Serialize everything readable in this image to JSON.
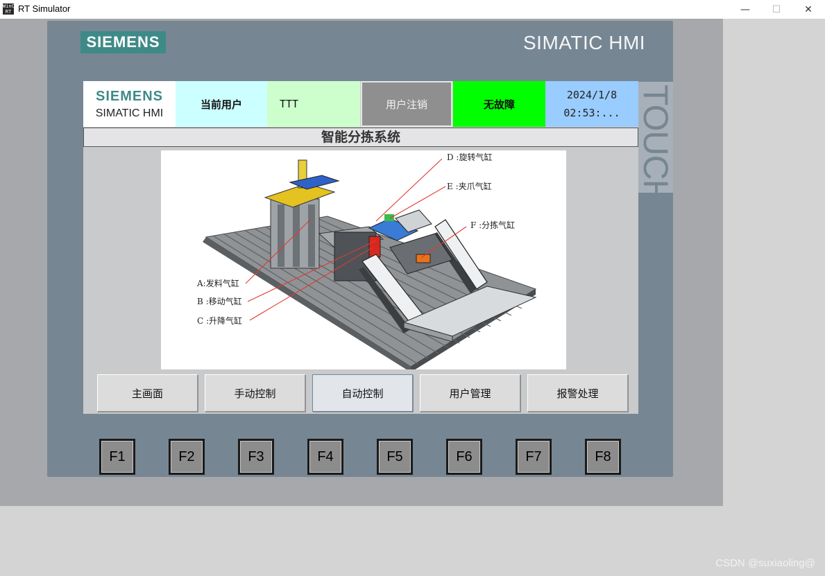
{
  "window": {
    "title": "RT Simulator",
    "icon_text": "WinCC RT",
    "minimize": "—",
    "maximize": "☐",
    "close": "✕"
  },
  "panel": {
    "logo": "SIEMENS",
    "brand": "SIMATIC HMI",
    "touch_label": "TOUCH"
  },
  "header": {
    "logo_line1": "SIEMENS",
    "logo_line2": "SIMATIC HMI",
    "user_label": "当前用户",
    "user_value": "TTT",
    "logout_label": "用户注销",
    "status": "无故障",
    "date": "2024/1/8",
    "time": "02:53:..."
  },
  "screen_title": "智能分拣系统",
  "figure": {
    "labels": {
      "a": "A:发料气缸",
      "b": "B :移动气缸",
      "c": "C :升降气缸",
      "d": "D :旋转气缸",
      "e": "E :夹爪气缸",
      "f": "F :分拣气缸"
    }
  },
  "nav": [
    "主画面",
    "手动控制",
    "自动控制",
    "用户管理",
    "报警处理"
  ],
  "fkeys": [
    "F1",
    "F2",
    "F3",
    "F4",
    "F5",
    "F6",
    "F7",
    "F8"
  ],
  "watermark": "CSDN @suxiaoling@",
  "colors": {
    "siemens_teal": "#3e8a88",
    "status_ok": "#00ff00",
    "user_label_bg": "#ccffff",
    "user_value_bg": "#ccffcc",
    "datetime_bg": "#99ccff",
    "bezel": "#778693"
  }
}
